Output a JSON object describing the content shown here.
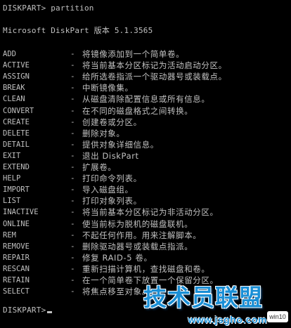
{
  "prompt_command": "DISKPART> partition",
  "version_line": "Microsoft DiskPart 版本 5.1.3565",
  "dash": "-",
  "commands": [
    {
      "name": "ADD",
      "desc": "将镜像添加到一个简单卷。"
    },
    {
      "name": "ACTIVE",
      "desc": "将当前基本分区标记为活动启动分区。"
    },
    {
      "name": "ASSIGN",
      "desc": "给所选卷指派一个驱动器号或装载点。"
    },
    {
      "name": "BREAK",
      "desc": "中断镜像集。"
    },
    {
      "name": "CLEAN",
      "desc": "从磁盘清除配置信息或所有信息。"
    },
    {
      "name": "CONVERT",
      "desc": "在不同的磁盘格式之间转换。"
    },
    {
      "name": "CREATE",
      "desc": "创建卷或分区。"
    },
    {
      "name": "DELETE",
      "desc": "删除对象。"
    },
    {
      "name": "DETAIL",
      "desc": "提供对象详细信息。"
    },
    {
      "name": "EXIT",
      "desc": "退出 DiskPart"
    },
    {
      "name": "EXTEND",
      "desc": "扩展卷。"
    },
    {
      "name": "HELP",
      "desc": "打印命令列表。"
    },
    {
      "name": "IMPORT",
      "desc": "导入磁盘组。"
    },
    {
      "name": "LIST",
      "desc": "打印对象列表。"
    },
    {
      "name": "INACTIVE",
      "desc": "将当前基本分区标记为非活动分区。"
    },
    {
      "name": "ONLINE",
      "desc": "使当前标为脱机的磁盘联机。"
    },
    {
      "name": "REM",
      "desc": "不起任何作用。用来注解脚本。"
    },
    {
      "name": "REMOVE",
      "desc": "删除驱动器号或装载点指派。"
    },
    {
      "name": "REPAIR",
      "desc": "修复 RAID-5 卷。"
    },
    {
      "name": "RESCAN",
      "desc": "重新扫描计算机，查找磁盘和卷。"
    },
    {
      "name": "RETAIN",
      "desc": "在一个简单卷下放置一个保留分区。"
    },
    {
      "name": "SELECT",
      "desc": "将焦点移至对象。"
    }
  ],
  "prompt_idle": "DISKPART>",
  "watermark": {
    "logo_text": "技术员联盟",
    "url": "www.jsgho.com",
    "badge": "win10"
  },
  "colors": {
    "background": "#000000",
    "text": "#c0c0c0",
    "watermark": "#1a8fd6"
  }
}
